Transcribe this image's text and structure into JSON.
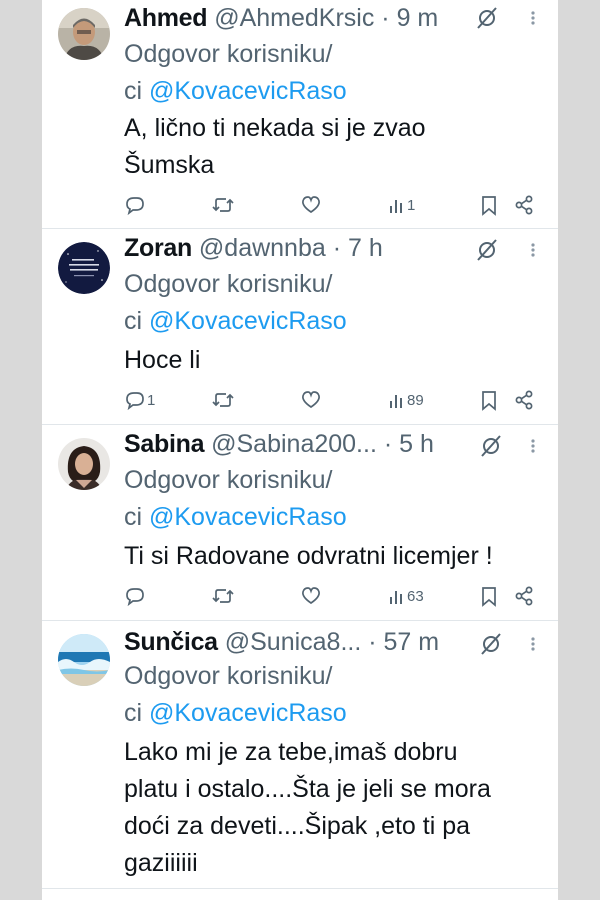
{
  "colors": {
    "accent": "#1d9bf0",
    "secondary_text": "#536471",
    "primary_text": "#0f1419"
  },
  "tweets": [
    {
      "name": "Ahmed",
      "handle": "@AhmedKrsic",
      "dot": "·",
      "time": "9 m",
      "reply_line1": "Odgovor korisniku/",
      "reply_prefix": "ci ",
      "reply_mention": "@KovacevicRaso",
      "text_lines": [
        "A, lično ti nekada si je zvao",
        "Šumska"
      ],
      "replies": "",
      "retweets": "",
      "likes": "",
      "views": "1",
      "avatar": "photo-man-avatar"
    },
    {
      "name": "Zoran",
      "handle": "@dawnnba",
      "dot": "·",
      "time": "7 h",
      "reply_line1": "Odgovor korisniku/",
      "reply_prefix": "ci ",
      "reply_mention": "@KovacevicRaso",
      "text_lines": [
        "Hoce li"
      ],
      "replies": "1",
      "retweets": "",
      "likes": "",
      "views": "89",
      "avatar": "quote-text-avatar"
    },
    {
      "name": "Sabina",
      "handle": "@Sabina200...",
      "dot": "·",
      "time": "5 h",
      "reply_line1": "Odgovor korisniku/",
      "reply_prefix": "ci ",
      "reply_mention": "@KovacevicRaso",
      "text_lines": [
        "Ti si Radovane  odvratni licemjer !"
      ],
      "replies": "",
      "retweets": "",
      "likes": "",
      "views": "63",
      "avatar": "photo-woman-avatar"
    },
    {
      "name": "Sunčica",
      "handle": "@Sunica8...",
      "dot": "·",
      "time": "57 m",
      "reply_line1": "Odgovor korisniku/",
      "reply_prefix": "ci ",
      "reply_mention": "@KovacevicRaso",
      "text_lines": [
        "Lako mi je za tebe,imaš dobru",
        "platu i ostalo....Šta je jeli se mora",
        "doći za deveti....Šipak ,eto ti pa",
        "gaziiiiii"
      ],
      "replies": "",
      "retweets": "",
      "likes": "",
      "views": "",
      "avatar": "sea-wave-avatar"
    }
  ]
}
